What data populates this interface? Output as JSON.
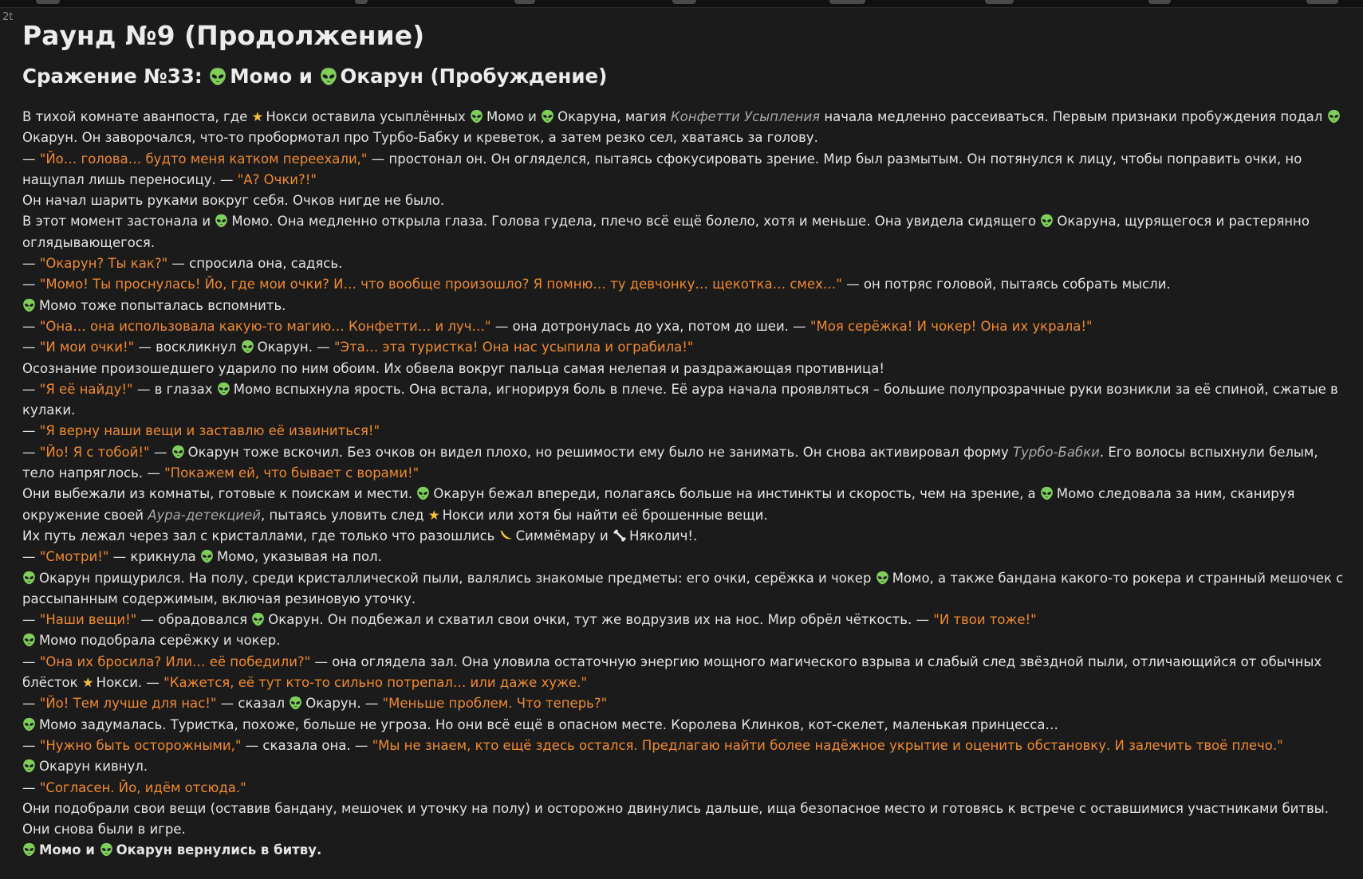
{
  "corner_label": "2t",
  "title": "Раунд №9 (Продолжение)",
  "subtitle": {
    "prefix": "Сражение №33:",
    "name1": "Момо",
    "and": "и",
    "name2": "Окарун (Пробуждение)"
  },
  "icons": {
    "alien": "alien-emoji-icon",
    "star": "star-icon",
    "banana": "banana-icon",
    "bone": "bone-icon"
  },
  "paragraphs": [
    [
      {
        "t": "text",
        "v": "В тихой комнате аванпоста, где "
      },
      {
        "t": "star"
      },
      {
        "t": "text",
        "v": "Нокси оставила усыплённых "
      },
      {
        "t": "alien"
      },
      {
        "t": "text",
        "v": "Момо и "
      },
      {
        "t": "alien"
      },
      {
        "t": "text",
        "v": "Окаруна, магия "
      },
      {
        "t": "it",
        "v": "Конфетти Усыпления"
      },
      {
        "t": "text",
        "v": " начала медленно рассеиваться. Первым признаки пробуждения подал "
      },
      {
        "t": "alien"
      },
      {
        "t": "text",
        "v": "Окарун. Он заворочался, что-то пробормотал про Турбо-Бабку и креветок, а затем резко сел, хватаясь за голову."
      }
    ],
    [
      {
        "t": "text",
        "v": "— "
      },
      {
        "t": "sp",
        "v": "\"Йо… голова… будто меня катком переехали,\""
      },
      {
        "t": "text",
        "v": " — простонал он. Он огляделся, пытаясь сфокусировать зрение. Мир был размытым. Он потянулся к лицу, чтобы поправить очки, но нащупал лишь переносицу. — "
      },
      {
        "t": "sp",
        "v": "\"А? Очки?!\""
      }
    ],
    [
      {
        "t": "text",
        "v": "Он начал шарить руками вокруг себя. Очков нигде не было."
      }
    ],
    [
      {
        "t": "text",
        "v": "В этот момент застонала и "
      },
      {
        "t": "alien"
      },
      {
        "t": "text",
        "v": "Момо. Она медленно открыла глаза. Голова гудела, плечо всё ещё болело, хотя и меньше. Она увидела сидящего "
      },
      {
        "t": "alien"
      },
      {
        "t": "text",
        "v": "Окаруна, щурящегося и растерянно оглядывающегося."
      }
    ],
    [
      {
        "t": "text",
        "v": "— "
      },
      {
        "t": "sp",
        "v": "\"Окарун? Ты как?\""
      },
      {
        "t": "text",
        "v": " — спросила она, садясь."
      }
    ],
    [
      {
        "t": "text",
        "v": "— "
      },
      {
        "t": "sp",
        "v": "\"Момо! Ты проснулась! Йо, где мои очки? И… что вообще произошло? Я помню… ту девчонку… щекотка… смех…\""
      },
      {
        "t": "text",
        "v": " — он потряс головой, пытаясь собрать мысли."
      }
    ],
    [
      {
        "t": "alien"
      },
      {
        "t": "text",
        "v": "Момо тоже попыталась вспомнить."
      }
    ],
    [
      {
        "t": "text",
        "v": "— "
      },
      {
        "t": "sp",
        "v": "\"Она… она использовала какую-то магию… Конфетти… и луч…\""
      },
      {
        "t": "text",
        "v": " — она дотронулась до уха, потом до шеи. — "
      },
      {
        "t": "sp",
        "v": "\"Моя серёжка! И чокер! Она их украла!\""
      }
    ],
    [
      {
        "t": "text",
        "v": "— "
      },
      {
        "t": "sp",
        "v": "\"И мои очки!\""
      },
      {
        "t": "text",
        "v": " — воскликнул "
      },
      {
        "t": "alien"
      },
      {
        "t": "text",
        "v": "Окарун. — "
      },
      {
        "t": "sp",
        "v": "\"Эта… эта туристка! Она нас усыпила и ограбила!\""
      }
    ],
    [
      {
        "t": "text",
        "v": "Осознание произошедшего ударило по ним обоим. Их обвела вокруг пальца самая нелепая и раздражающая противница!"
      }
    ],
    [
      {
        "t": "text",
        "v": "— "
      },
      {
        "t": "sp",
        "v": "\"Я её найду!\""
      },
      {
        "t": "text",
        "v": " — в глазах "
      },
      {
        "t": "alien"
      },
      {
        "t": "text",
        "v": "Момо вспыхнула ярость. Она встала, игнорируя боль в плече. Её аура начала проявляться – большие полупрозрачные руки возникли за её спиной, сжатые в кулаки."
      }
    ],
    [
      {
        "t": "text",
        "v": "— "
      },
      {
        "t": "sp",
        "v": "\"Я верну наши вещи и заставлю её извиниться!\""
      }
    ],
    [
      {
        "t": "text",
        "v": "— "
      },
      {
        "t": "sp",
        "v": "\"Йо! Я с тобой!\""
      },
      {
        "t": "text",
        "v": " — "
      },
      {
        "t": "alien"
      },
      {
        "t": "text",
        "v": "Окарун тоже вскочил. Без очков он видел плохо, но решимости ему было не занимать. Он снова активировал форму "
      },
      {
        "t": "it",
        "v": "Турбо-Бабки"
      },
      {
        "t": "text",
        "v": ". Его волосы вспыхнули белым, тело напряглось. — "
      },
      {
        "t": "sp",
        "v": "\"Покажем ей, что бывает с ворами!\""
      }
    ],
    [
      {
        "t": "text",
        "v": "Они выбежали из комнаты, готовые к поискам и мести. "
      },
      {
        "t": "alien"
      },
      {
        "t": "text",
        "v": "Окарун бежал впереди, полагаясь больше на инстинкты и скорость, чем на зрение, а "
      },
      {
        "t": "alien"
      },
      {
        "t": "text",
        "v": "Момо следовала за ним, сканируя окружение своей "
      },
      {
        "t": "it",
        "v": "Аура-детекцией"
      },
      {
        "t": "text",
        "v": ", пытаясь уловить след "
      },
      {
        "t": "star"
      },
      {
        "t": "text",
        "v": "Нокси или хотя бы найти её брошенные вещи."
      }
    ],
    [
      {
        "t": "text",
        "v": "Их путь лежал через зал с кристаллами, где только что разошлись "
      },
      {
        "t": "banana"
      },
      {
        "t": "text",
        "v": "Симмёмару и "
      },
      {
        "t": "bone"
      },
      {
        "t": "text",
        "v": "Няколич!."
      }
    ],
    [
      {
        "t": "text",
        "v": "— "
      },
      {
        "t": "sp",
        "v": "\"Смотри!\""
      },
      {
        "t": "text",
        "v": " — крикнула "
      },
      {
        "t": "alien"
      },
      {
        "t": "text",
        "v": "Момо, указывая на пол."
      }
    ],
    [
      {
        "t": "alien"
      },
      {
        "t": "text",
        "v": "Окарун прищурился. На полу, среди кристаллической пыли, валялись знакомые предметы: его очки, серёжка и чокер "
      },
      {
        "t": "alien"
      },
      {
        "t": "text",
        "v": "Момо, а также бандана какого-то рокера и странный мешочек с рассыпанным содержимым, включая резиновую уточку."
      }
    ],
    [
      {
        "t": "text",
        "v": "— "
      },
      {
        "t": "sp",
        "v": "\"Наши вещи!\""
      },
      {
        "t": "text",
        "v": " — обрадовался "
      },
      {
        "t": "alien"
      },
      {
        "t": "text",
        "v": "Окарун. Он подбежал и схватил свои очки, тут же водрузив их на нос. Мир обрёл чёткость. — "
      },
      {
        "t": "sp",
        "v": "\"И твои тоже!\""
      }
    ],
    [
      {
        "t": "alien"
      },
      {
        "t": "text",
        "v": "Момо подобрала серёжку и чокер."
      }
    ],
    [
      {
        "t": "text",
        "v": "— "
      },
      {
        "t": "sp",
        "v": "\"Она их бросила? Или… её победили?\""
      },
      {
        "t": "text",
        "v": " — она оглядела зал. Она уловила остаточную энергию мощного магического взрыва и слабый след звёздной пыли, отличающийся от обычных блёсток "
      },
      {
        "t": "star"
      },
      {
        "t": "text",
        "v": "Нокси. — "
      },
      {
        "t": "sp",
        "v": "\"Кажется, её тут кто-то сильно потрепал… или даже хуже.\""
      }
    ],
    [
      {
        "t": "text",
        "v": "— "
      },
      {
        "t": "sp",
        "v": "\"Йо! Тем лучше для нас!\""
      },
      {
        "t": "text",
        "v": " — сказал "
      },
      {
        "t": "alien"
      },
      {
        "t": "text",
        "v": "Окарун. — "
      },
      {
        "t": "sp",
        "v": "\"Меньше проблем. Что теперь?\""
      }
    ],
    [
      {
        "t": "alien"
      },
      {
        "t": "text",
        "v": "Момо задумалась. Туристка, похоже, больше не угроза. Но они всё ещё в опасном месте. Королева Клинков, кот-скелет, маленькая принцесса…"
      }
    ],
    [
      {
        "t": "text",
        "v": "— "
      },
      {
        "t": "sp",
        "v": "\"Нужно быть осторожными,\""
      },
      {
        "t": "text",
        "v": " — сказала она. — "
      },
      {
        "t": "sp",
        "v": "\"Мы не знаем, кто ещё здесь остался. Предлагаю найти более надёжное укрытие и оценить обстановку. И залечить твоё плечо.\""
      }
    ],
    [
      {
        "t": "alien"
      },
      {
        "t": "text",
        "v": "Окарун кивнул."
      }
    ],
    [
      {
        "t": "text",
        "v": "— "
      },
      {
        "t": "sp",
        "v": "\"Согласен. Йо, идём отсюда.\""
      }
    ],
    [
      {
        "t": "text",
        "v": "Они подобрали свои вещи (оставив бандану, мешочек и уточку на полу) и осторожно двинулись дальше, ища безопасное место и готовясь к встрече с оставшимися участниками битвы. Они снова были в игре."
      }
    ],
    [
      {
        "t": "alien"
      },
      {
        "t": "bold",
        "v": "Момо и "
      },
      {
        "t": "alien"
      },
      {
        "t": "bold",
        "v": "Окарун вернулись в битву."
      }
    ]
  ]
}
